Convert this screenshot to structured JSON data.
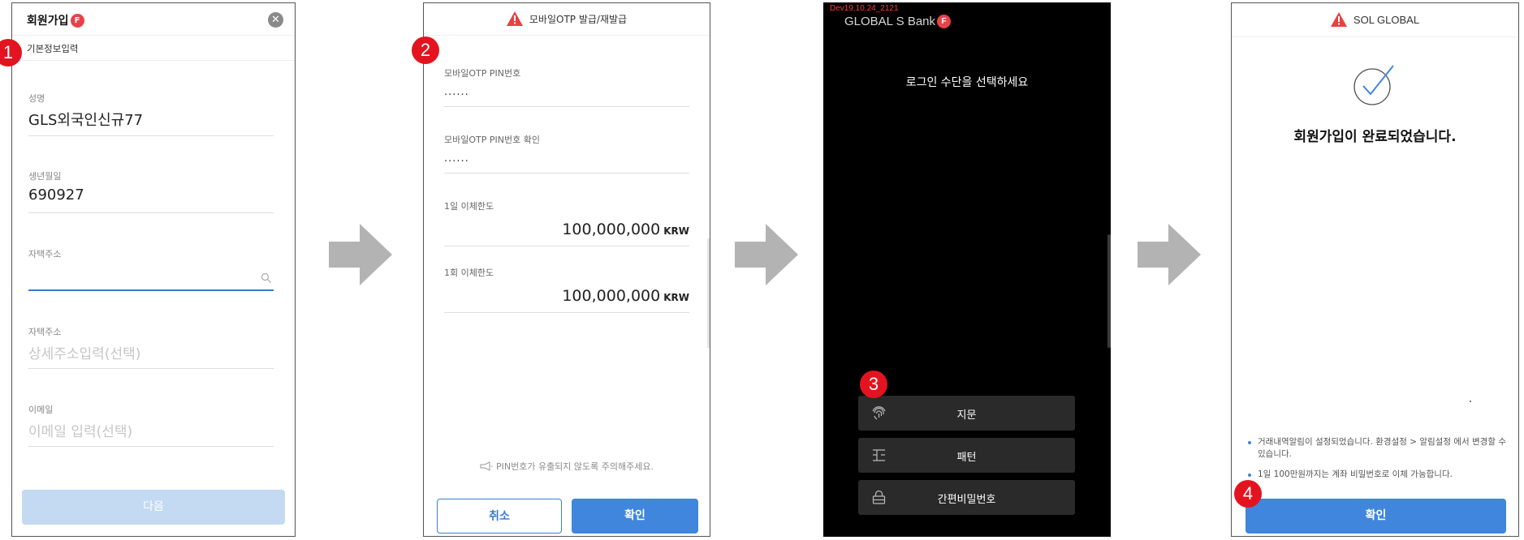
{
  "screen1": {
    "title": "회원가입",
    "title_badge": "F",
    "subtitle": "기본정보입력",
    "fields": [
      {
        "label": "성명",
        "value": "GLS외국인신규77"
      },
      {
        "label": "생년월일",
        "value": "690927"
      },
      {
        "label": "자택주소",
        "value": ""
      },
      {
        "label": "자택주소",
        "placeholder": "상세주소입력(선택)"
      },
      {
        "label": "이메일",
        "placeholder": "이메일 입력(선택)"
      }
    ],
    "next_label": "다음",
    "step": "1"
  },
  "screen2": {
    "title": "모바일OTP 발급/재발급",
    "fields": [
      {
        "label": "모바일OTP PIN번호",
        "value": "......"
      },
      {
        "label": "모바일OTP PIN번호 확인",
        "value": "......"
      },
      {
        "label": "1일 이체한도",
        "amount": "100,000,000",
        "currency": "KRW"
      },
      {
        "label": "1회 이체한도",
        "amount": "100,000,000",
        "currency": "KRW"
      }
    ],
    "notice": "PIN번호가 유출되지 않도록 주의해주세요.",
    "cancel_label": "취소",
    "confirm_label": "확인",
    "step": "2"
  },
  "screen3": {
    "dev_tag": "Dev19.10.24_2121",
    "bank_name": "GLOBAL S Bank",
    "bank_badge": "F",
    "prompt": "로그인 수단을 선택하세요",
    "options": [
      {
        "label": "지문",
        "icon": "fingerprint-icon"
      },
      {
        "label": "패턴",
        "icon": "pattern-icon"
      },
      {
        "label": "간편비밀번호",
        "icon": "lock-icon"
      }
    ],
    "step": "3"
  },
  "screen4": {
    "title": "SOL GLOBAL",
    "message": "회원가입이 완료되었습니다.",
    "info": [
      "거래내역알림이 설정되었습니다. 환경설정 > 알림설정 에서 변경할 수 있습니다.",
      "1일 100만원까지는 계좌 비밀번호로 이체 가능합니다."
    ],
    "confirm_label": "확인",
    "step": "4"
  },
  "colors": {
    "accent_blue": "#3f86dc",
    "disabled_blue": "#c4d9f2",
    "badge_red": "#e3141f",
    "warning_red": "#e84141",
    "arrow_gray": "#b3b3b3"
  }
}
